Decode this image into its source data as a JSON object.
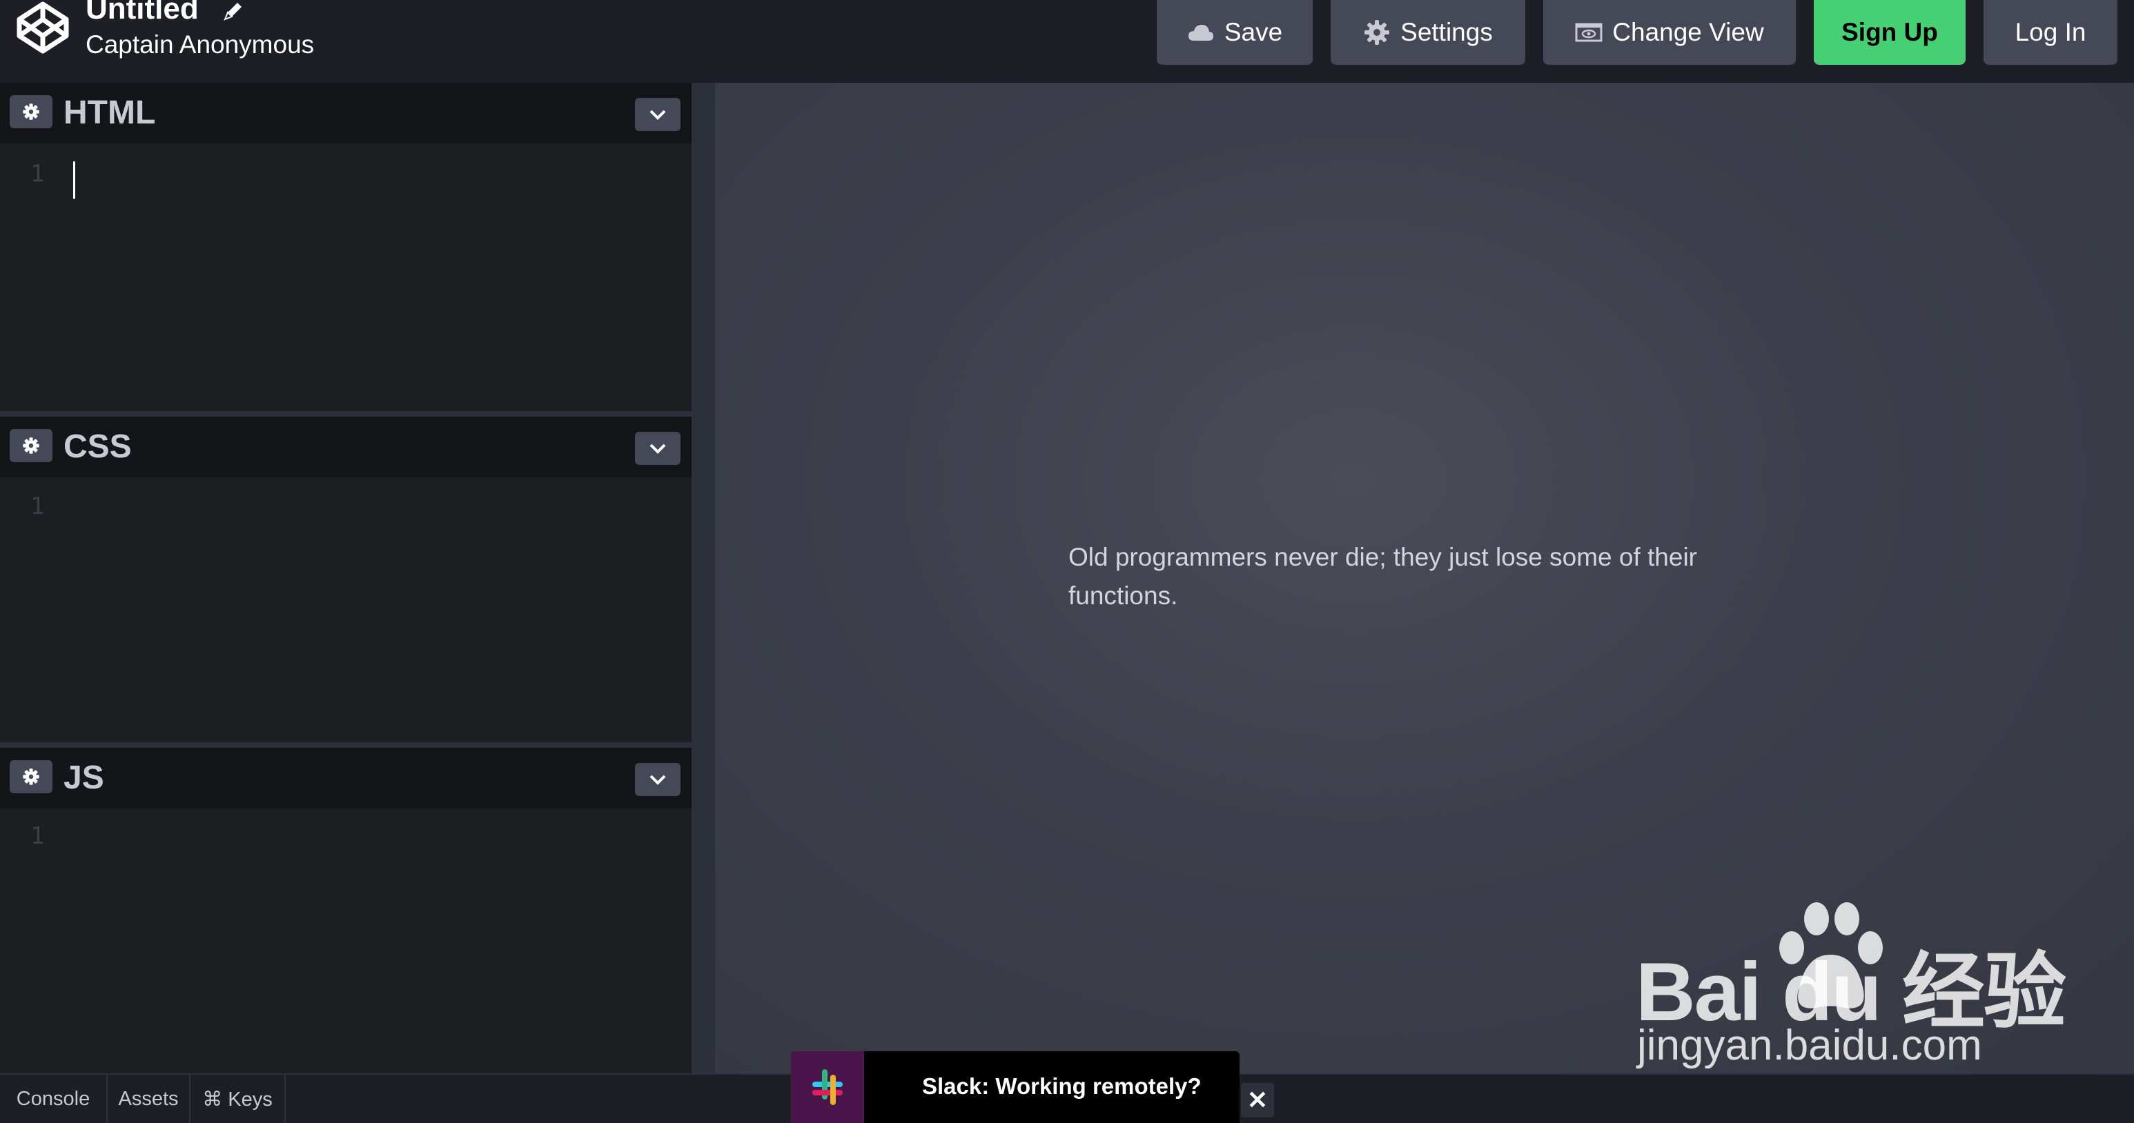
{
  "header": {
    "title": "Untitled",
    "author": "Captain Anonymous",
    "buttons": {
      "save": "Save",
      "settings": "Settings",
      "change_view": "Change View",
      "sign_up": "Sign Up",
      "log_in": "Log In"
    },
    "icons": {
      "logo": "codepen-logo-icon",
      "edit": "pencil-icon",
      "save": "cloud-icon",
      "settings": "gear-icon",
      "view": "window-icon"
    },
    "accent_color": "#47cf73"
  },
  "editors": [
    {
      "title": "HTML",
      "line": "1"
    },
    {
      "title": "CSS",
      "line": "1"
    },
    {
      "title": "JS",
      "line": "1"
    }
  ],
  "preview": {
    "text": "Old programmers never die; they just lose some of their functions."
  },
  "bottombar": {
    "tabs": [
      "Console",
      "Assets",
      "⌘ Keys"
    ]
  },
  "ad": {
    "text": "Slack: Working remotely?",
    "close": "✕"
  },
  "watermark": {
    "brand": "Bai  du 经验",
    "url": "jingyan.baidu.com"
  }
}
